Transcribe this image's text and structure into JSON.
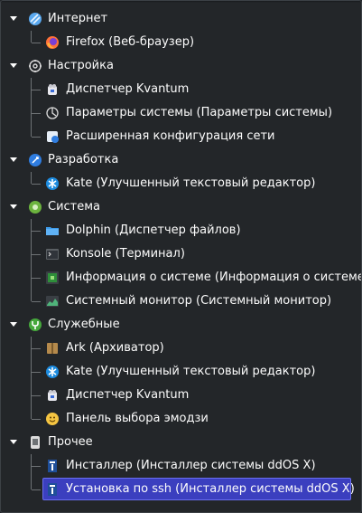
{
  "tree": {
    "categories": [
      {
        "label": "Интернет",
        "icon": "globe-icon",
        "items": [
          {
            "label": "Firefox (Веб-браузер)",
            "icon": "firefox-icon"
          }
        ]
      },
      {
        "label": "Настройка",
        "icon": "settings-gear-icon",
        "items": [
          {
            "label": "Диспетчер Kvantum",
            "icon": "kvantum-icon"
          },
          {
            "label": "Параметры системы (Параметры системы)",
            "icon": "system-settings-icon"
          },
          {
            "label": "Расширенная конфигурация сети",
            "icon": "network-config-icon"
          }
        ]
      },
      {
        "label": "Разработка",
        "icon": "development-icon",
        "items": [
          {
            "label": "Kate (Улучшенный текстовый редактор)",
            "icon": "kate-icon"
          }
        ]
      },
      {
        "label": "Система",
        "icon": "system-icon",
        "items": [
          {
            "label": "Dolphin (Диспетчер файлов)",
            "icon": "dolphin-folder-icon"
          },
          {
            "label": "Konsole (Терминал)",
            "icon": "konsole-terminal-icon"
          },
          {
            "label": "Информация о системе (Информация о системе)",
            "icon": "system-info-icon"
          },
          {
            "label": "Системный монитор (Системный монитор)",
            "icon": "system-monitor-icon"
          }
        ]
      },
      {
        "label": "Служебные",
        "icon": "utilities-icon",
        "items": [
          {
            "label": "Ark (Архиватор)",
            "icon": "ark-archiver-icon"
          },
          {
            "label": "Kate (Улучшенный текстовый редактор)",
            "icon": "kate-icon"
          },
          {
            "label": "Диспетчер Kvantum",
            "icon": "kvantum-icon"
          },
          {
            "label": "Панель выбора эмодзи",
            "icon": "emoji-icon"
          }
        ]
      },
      {
        "label": "Прочее",
        "icon": "other-icon",
        "items": [
          {
            "label": "Инсталлер (Инсталлер системы ddOS X)",
            "icon": "installer-icon"
          },
          {
            "label": "Установка по ssh (Инсталлер системы ddOS X)",
            "icon": "ssh-installer-icon",
            "selected": true
          }
        ]
      }
    ]
  },
  "colors": {
    "background": "#232629",
    "text": "#fcfcfc",
    "selection": "#3b3fbf",
    "selection_border": "#6a6ef0",
    "tree_lines": "#6e7275"
  }
}
